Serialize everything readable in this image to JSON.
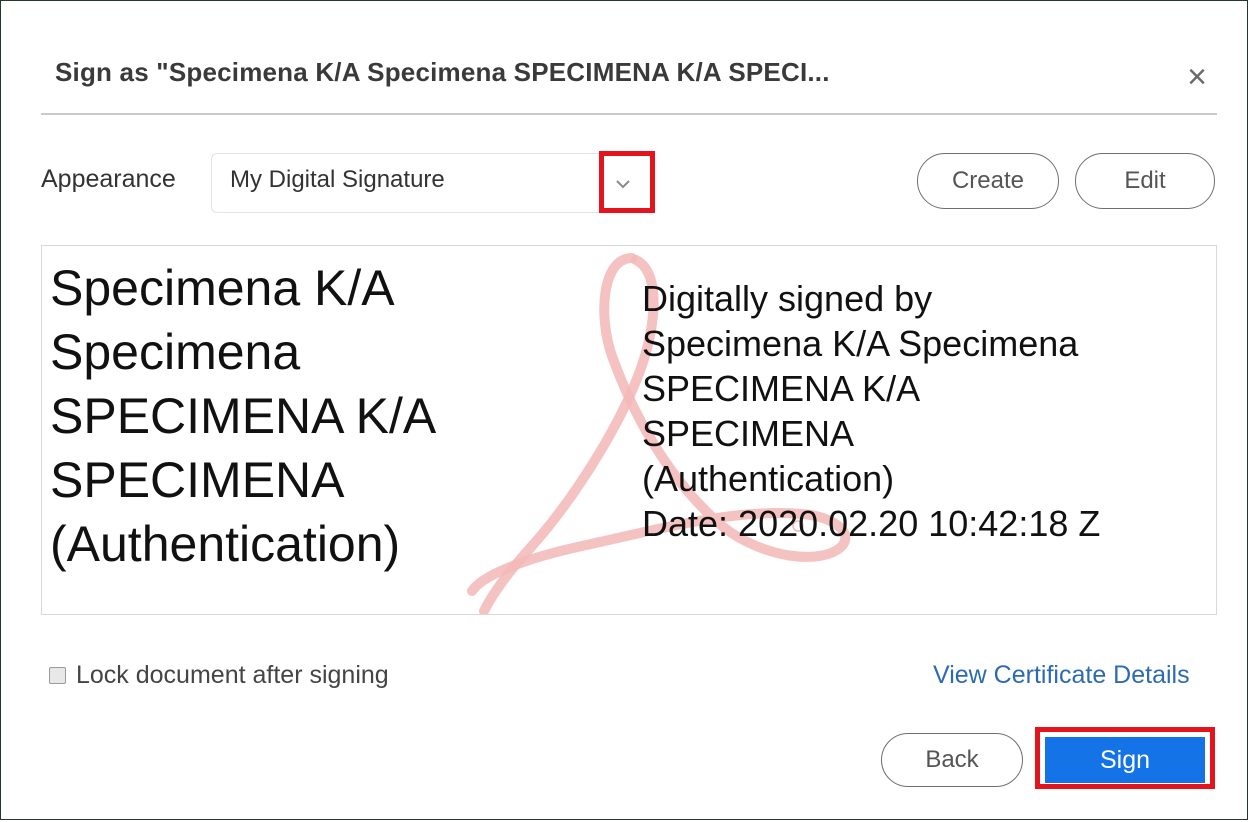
{
  "dialog": {
    "title": "Sign as \"Specimena K/A Specimena SPECIMENA K/A SPECI...",
    "close_icon": "close-icon"
  },
  "appearance": {
    "label": "Appearance",
    "selected": "My Digital Signature",
    "create_label": "Create",
    "edit_label": "Edit"
  },
  "preview": {
    "name_lines": [
      "Specimena K/A",
      "Specimena",
      "SPECIMENA K/A",
      "SPECIMENA",
      "(Authentication)"
    ],
    "detail_lines": [
      "Digitally signed by",
      "Specimena K/A Specimena",
      "SPECIMENA K/A",
      "SPECIMENA",
      "(Authentication)",
      "Date: 2020.02.20 10:42:18 Z"
    ],
    "watermark": "acrobat-logo-watermark"
  },
  "options": {
    "lock_label": "Lock document after signing",
    "cert_link": "View Certificate Details"
  },
  "buttons": {
    "back_label": "Back",
    "sign_label": "Sign"
  },
  "colors": {
    "highlight": "#e5131c",
    "primary": "#1473e6",
    "link": "#2d6bb0"
  }
}
